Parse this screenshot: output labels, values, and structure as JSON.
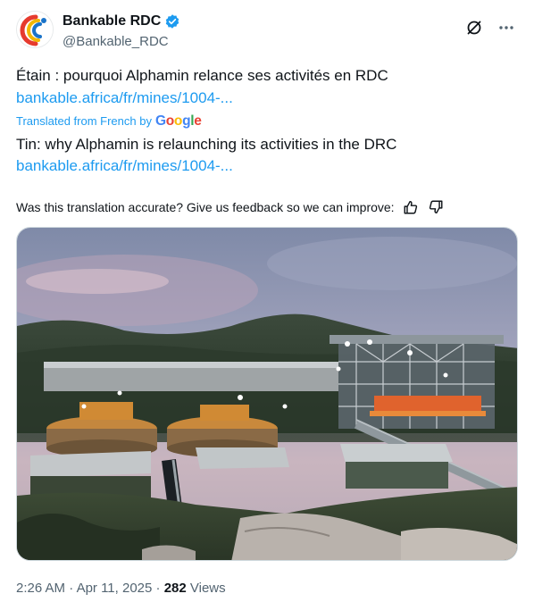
{
  "author": {
    "display_name": "Bankable RDC",
    "handle": "@Bankable_RDC"
  },
  "tweet": {
    "original_text": "Étain : pourquoi Alphamin relance ses activités en RDC",
    "original_link": "bankable.africa/fr/mines/1004-...",
    "translated_label": "Translated from French by",
    "translation_provider": [
      "G",
      "o",
      "o",
      "g",
      "l",
      "e"
    ],
    "translated_text": "Tin: why Alphamin is relaunching its activities in the DRC",
    "translated_link": "bankable.africa/fr/mines/1004-..."
  },
  "feedback": {
    "question": "Was this translation accurate? Give us feedback so we can improve:"
  },
  "meta": {
    "time": "2:26 AM",
    "separator1": " · ",
    "date": "Apr 11, 2025",
    "separator2": " · ",
    "views_count": "282",
    "views_label": " Views"
  },
  "colors": {
    "link": "#1d9bf0",
    "verified": "#1d9bf0",
    "muted": "#536471"
  },
  "icons": {
    "grok": "grok-slash-icon",
    "more": "more-horizontal-icon",
    "thumb_up": "thumbs-up-icon",
    "thumb_down": "thumbs-down-icon",
    "verified": "verified-badge-icon"
  }
}
